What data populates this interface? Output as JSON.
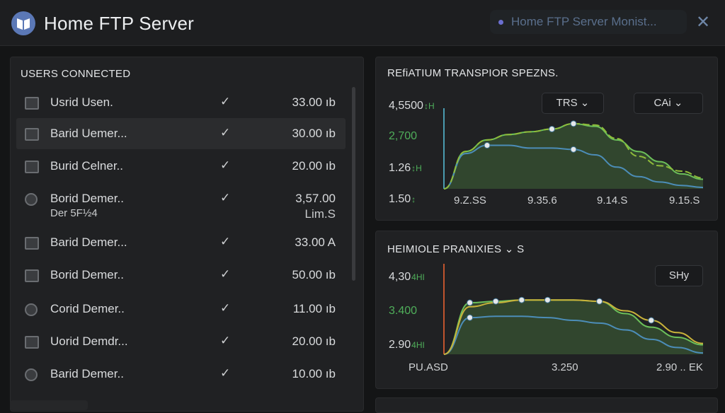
{
  "app": {
    "title": "Home FTP Server",
    "notification": "Home FTP Server Monist...",
    "close_icon": "close-icon"
  },
  "users_panel": {
    "title": "USERS CONNECTED",
    "rows": [
      {
        "name": "Usrid Usen.",
        "size": "33.00 ıb",
        "icon": "user-icon",
        "selected": false
      },
      {
        "name": "Barid Uemer...",
        "size": "30.00 ıb",
        "icon": "user-icon",
        "selected": true
      },
      {
        "name": "Burid Celner..",
        "size": "20.00 ıb",
        "icon": "user-icon",
        "selected": false
      },
      {
        "name": "Borid Demer..",
        "name2": "Der 5F½4",
        "size": "3,57.00",
        "size2": "Lim.S",
        "icon": "user-round-icon",
        "selected": false
      },
      {
        "name": "Barid Demer...",
        "size": "33.00 A",
        "icon": "user-icon",
        "selected": false
      },
      {
        "name": "Borid Demer..",
        "size": "50.00 ıb",
        "icon": "user-icon",
        "selected": false
      },
      {
        "name": "Corid Demer..",
        "size": "11.00 ıb",
        "icon": "user-round-icon",
        "selected": false
      },
      {
        "name": "Uorid Demdr...",
        "size": "20.00 ıb",
        "icon": "user-icon",
        "selected": false
      },
      {
        "name": "Barid Demer..",
        "size": "10.00 ıb",
        "icon": "user-round-icon",
        "selected": false
      }
    ]
  },
  "chart_data": [
    {
      "type": "line",
      "title": "REfiATIUM TRANSPIOR SPEZNS.",
      "dropdowns": [
        "TRS ⌄",
        "CAi ⌄"
      ],
      "y_tick_labels": [
        {
          "text": "4,5500",
          "unit": "↕H",
          "color": "#d9dbdd"
        },
        {
          "text": "2,700",
          "unit": "",
          "color": "#4fae5a"
        },
        {
          "text": "1.26",
          "unit": "↕H",
          "color": "#d9dbdd"
        },
        {
          "text": "1.50",
          "unit": "↕",
          "color": "#d9dbdd"
        }
      ],
      "x_tick_labels": [
        "9.Z.SS",
        "9.35.6",
        "9.14.S",
        "9.15.S"
      ],
      "series": [
        {
          "values": [
            0.0,
            0.55,
            0.72,
            0.8,
            0.84,
            0.88,
            0.96,
            0.92,
            0.72,
            0.55,
            0.4,
            0.22,
            0.14
          ],
          "color": "#6cc05a",
          "fill": true
        },
        {
          "values": [
            0.0,
            0.52,
            0.64,
            0.64,
            0.6,
            0.6,
            0.58,
            0.5,
            0.32,
            0.18,
            0.1,
            0.05,
            0.02
          ],
          "color": "#4c8db8",
          "fill": false
        },
        {
          "values": [
            0.0,
            0.55,
            0.72,
            0.8,
            0.84,
            0.88,
            0.96,
            0.94,
            0.74,
            0.48,
            0.34,
            0.26,
            0.16
          ],
          "color": "#8fbc3a",
          "fill": false,
          "dashed": true
        }
      ],
      "markers": [
        {
          "series": 1,
          "index": 2
        },
        {
          "series": 0,
          "index": 5
        },
        {
          "series": 0,
          "index": 6
        },
        {
          "series": 1,
          "index": 6
        }
      ]
    },
    {
      "type": "line",
      "title": "HEIMIOLE PRANIXIES ⌄ S",
      "dropdowns": [
        "SHy"
      ],
      "y_tick_labels": [
        {
          "text": "4,30",
          "unit": "4HI",
          "color": "#d9dbdd"
        },
        {
          "text": "3.400",
          "unit": "",
          "color": "#4fae5a"
        },
        {
          "text": "2.90",
          "unit": "4HI",
          "color": "#d9dbdd"
        }
      ],
      "x_tick_labels": [
        "PU.ASD",
        "3.250",
        "2.90 .. EK"
      ],
      "series": [
        {
          "values": [
            0.0,
            0.76,
            0.78,
            0.8,
            0.8,
            0.8,
            0.78,
            0.6,
            0.4,
            0.25,
            0.14
          ],
          "color": "#6cc05a",
          "fill": true
        },
        {
          "values": [
            0.0,
            0.54,
            0.56,
            0.56,
            0.54,
            0.5,
            0.46,
            0.36,
            0.22,
            0.1,
            0.02
          ],
          "color": "#4c8db8",
          "fill": false
        },
        {
          "values": [
            0.0,
            0.7,
            0.76,
            0.8,
            0.8,
            0.8,
            0.78,
            0.64,
            0.5,
            0.32,
            0.16
          ],
          "color": "#c9b23a",
          "fill": false
        }
      ],
      "markers": [
        {
          "series": 0,
          "index": 1
        },
        {
          "series": 0,
          "index": 2
        },
        {
          "series": 0,
          "index": 3
        },
        {
          "series": 0,
          "index": 4
        },
        {
          "series": 0,
          "index": 6
        },
        {
          "series": 2,
          "index": 8
        },
        {
          "series": 1,
          "index": 1
        }
      ]
    }
  ]
}
